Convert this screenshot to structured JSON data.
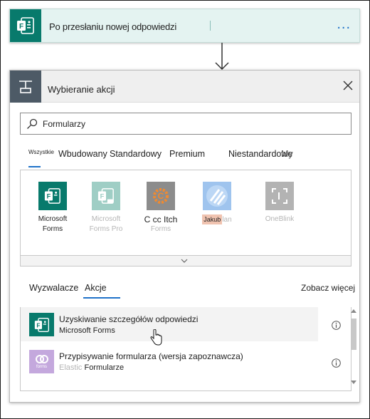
{
  "trigger": {
    "title": "Po przesłaniu nowej odpowiedzi",
    "icon": "forms-icon",
    "more": "..."
  },
  "action": {
    "title": "Wybieranie akcji",
    "icon": "action-icon"
  },
  "search": {
    "value": "Formularzy",
    "icon": "search-icon"
  },
  "tabs": [
    {
      "label": "Wszystkie"
    },
    {
      "label": "Wbudowany"
    },
    {
      "label": "Standardowy"
    },
    {
      "label": "Premium"
    },
    {
      "label": "Niestandardowe"
    },
    {
      "label": "My"
    }
  ],
  "connectors": [
    {
      "name_line1": "Microsoft",
      "name_line2": "Forms"
    },
    {
      "name_line1": "Microsoft",
      "name_line2": "Forms Pro"
    },
    {
      "name_line1": "C cc Itch",
      "name_line2": "Forms"
    },
    {
      "name_highlight": "Jakub",
      "name_rest": "lan"
    },
    {
      "name_line1": "OneBlink"
    }
  ],
  "sub_tabs": {
    "triggers": "Wyzwalacze",
    "actions": "Akcje",
    "see_more": "Zobacz więcej"
  },
  "results": [
    {
      "title": "Uzyskiwanie szczegółów odpowiedzi",
      "subtitle": "Microsoft Forms"
    },
    {
      "title": "Przypisywanie formularza (wersja zapoznawcza)",
      "subtitle_faint": "Elastic",
      "subtitle": "Formularze",
      "icon_caption": "forms"
    }
  ],
  "colors": {
    "forms_green": "#087a6c",
    "accent_blue": "#1f72c9",
    "action_gray": "#4d5a66"
  }
}
